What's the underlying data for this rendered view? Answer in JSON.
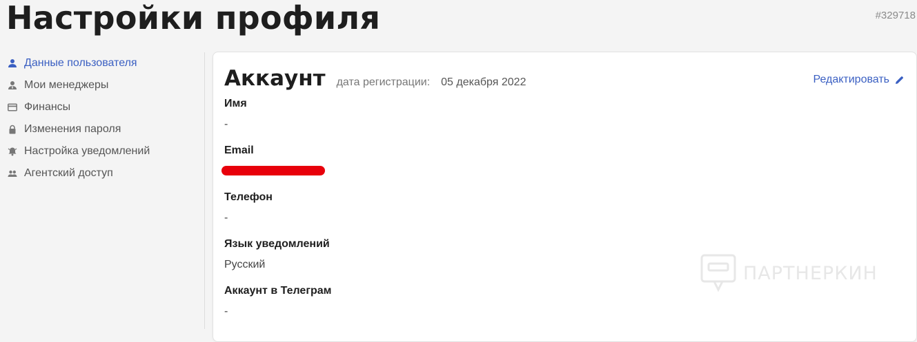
{
  "header": {
    "title": "Настройки профиля",
    "user_id": "#329718"
  },
  "sidebar": {
    "items": [
      {
        "label": "Данные пользователя",
        "icon": "user-icon",
        "active": true
      },
      {
        "label": "Мои менеджеры",
        "icon": "manager-icon",
        "active": false
      },
      {
        "label": "Финансы",
        "icon": "credit-card-icon",
        "active": false
      },
      {
        "label": "Изменения пароля",
        "icon": "lock-icon",
        "active": false
      },
      {
        "label": "Настройка уведомлений",
        "icon": "bell-icon",
        "active": false
      },
      {
        "label": "Агентский доступ",
        "icon": "group-icon",
        "active": false
      }
    ]
  },
  "account": {
    "title": "Аккаунт",
    "registration_label": "дата регистрации:",
    "registration_date": "05 декабря 2022",
    "edit_label": "Редактировать",
    "fields": [
      {
        "label": "Имя",
        "value": "-"
      },
      {
        "label": "Email",
        "value": ""
      },
      {
        "label": "Телефон",
        "value": "-"
      },
      {
        "label": "Язык уведомлений",
        "value": "Русский"
      },
      {
        "label": "Аккаунт в Телеграм",
        "value": "-"
      }
    ]
  },
  "watermark": {
    "text": "ПАРТНЕРКИН"
  },
  "colors": {
    "accent": "#3a5fc2",
    "redaction": "#e8000b",
    "background": "#f4f4f4"
  }
}
